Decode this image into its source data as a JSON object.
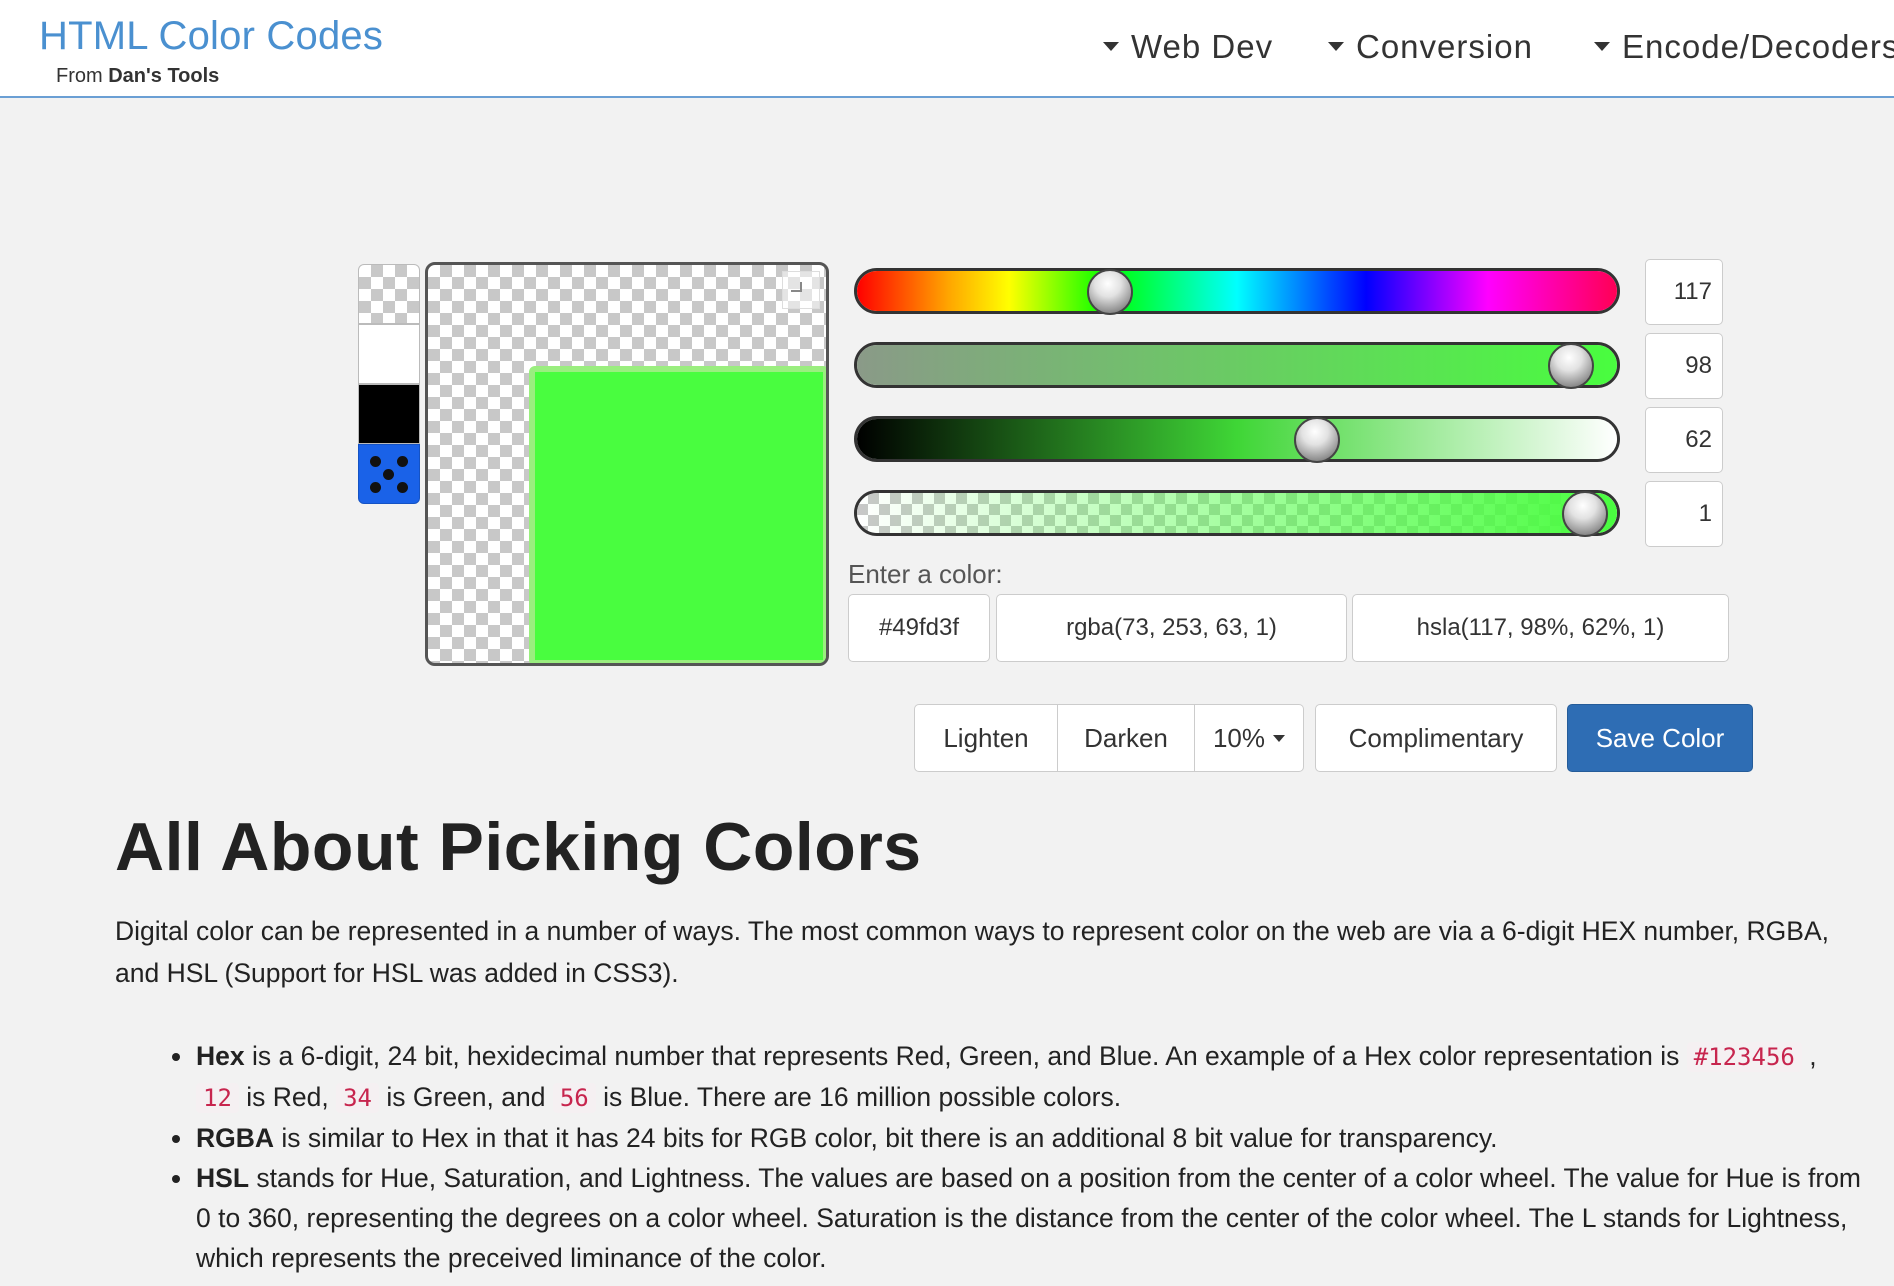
{
  "header": {
    "brand_title": "HTML Color Codes",
    "brand_sub_prefix": "From",
    "brand_sub_name": "Dan's Tools",
    "nav": [
      "Web Dev",
      "Conversion",
      "Encode/Decoders"
    ]
  },
  "picker": {
    "swatches": [
      "transparent-swatch",
      "white-swatch",
      "black-swatch",
      "dice-icon"
    ],
    "current_color": "#49fd3f",
    "sliders": {
      "hue": 117,
      "saturation": 98,
      "lightness": 62,
      "alpha": 1
    },
    "slider_fraction": {
      "hue": 0.325,
      "saturation": 0.98,
      "lightness": 0.62,
      "alpha": 1.0
    },
    "enter_label": "Enter a color:",
    "hex": "#49fd3f",
    "rgba": "rgba(73, 253, 63, 1)",
    "hsla": "hsla(117, 98%, 62%, 1)"
  },
  "actions": {
    "lighten": "Lighten",
    "darken": "Darken",
    "percent": "10%",
    "complimentary": "Complimentary",
    "save": "Save Color"
  },
  "article": {
    "title": "All About Picking Colors",
    "intro": "Digital color can be represented in a number of ways. The most common ways to represent color on the web are via a 6-digit HEX number, RGBA, and HSL (Support for HSL was added in CSS3).",
    "hex_term": "Hex",
    "hex_text_1": " is a 6-digit, 24 bit, hexidecimal number that represents Red, Green, and Blue. An example of a Hex color representation is ",
    "hex_code": "#123456",
    "hex_text_2": " ,",
    "hex_red_code": "12",
    "hex_text_3": " is Red, ",
    "hex_green_code": "34",
    "hex_text_4": " is Green, and ",
    "hex_blue_code": "56",
    "hex_text_5": " is Blue. There are 16 million possible colors.",
    "rgba_term": "RGBA",
    "rgba_text": " is similar to Hex in that it has 24 bits for RGB color, bit there is an additional 8 bit value for transparency.",
    "hsl_term": "HSL",
    "hsl_text": " stands for Hue, Saturation, and Lightness. The values are based on a position from the center of a color wheel. The value for Hue is from 0 to 360, representing the degrees on a color wheel. Saturation is the distance from the center of the color wheel. The L stands for Lightness, which represents the preceived liminance of the color."
  },
  "colors": {
    "brand": "#4a90d0",
    "save_button": "#2e6db4",
    "code_text": "#c7254e"
  }
}
